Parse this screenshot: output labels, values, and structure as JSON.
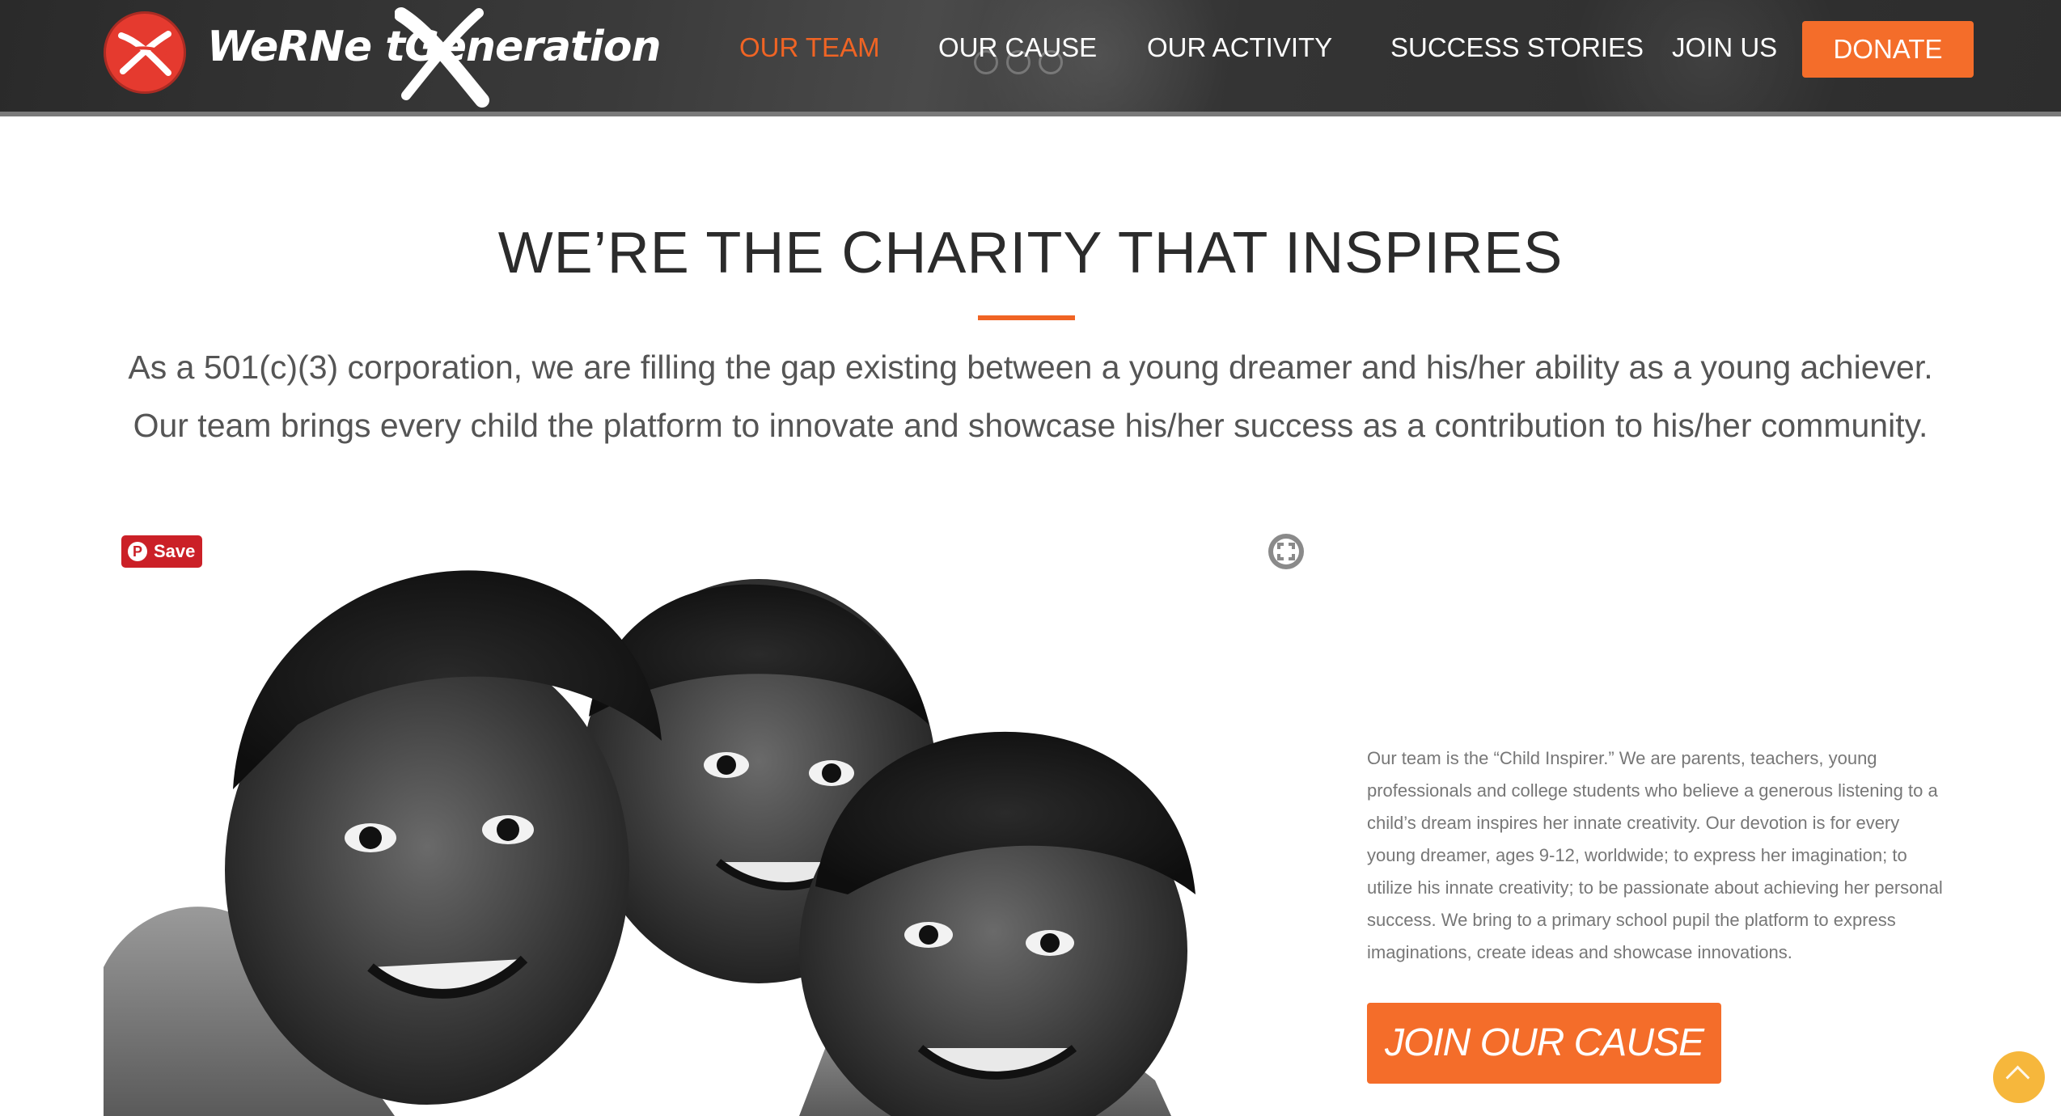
{
  "brand": {
    "name": "WeRNextGeneration",
    "logo_text": "WeRNe  tGeneration",
    "accent_color": "#f06424",
    "button_color": "#f46d2a",
    "logo_circle_color": "#e53a2f"
  },
  "nav": {
    "items": [
      {
        "label": "OUR TEAM",
        "active": true
      },
      {
        "label": "OUR CAUSE",
        "active": false
      },
      {
        "label": "OUR ACTIVITY",
        "active": false
      },
      {
        "label": "SUCCESS STORIES",
        "active": false
      },
      {
        "label": "JOIN US",
        "active": false
      }
    ],
    "donate_label": "DONATE"
  },
  "main": {
    "title": "WE’RE THE CHARITY THAT INSPIRES",
    "intro": "As a 501(c)(3) corporation, we are filling the gap existing between a young dreamer and his/her ability as a young achiever. Our team brings every child the platform to innovate and showcase his/her success as a contribution to his/her community."
  },
  "photo": {
    "save_label": "Save",
    "expand_icon": "expand-icon"
  },
  "team": {
    "description": "Our team is the “Child Inspirer.” We are parents, teachers, young professionals and college students who believe a generous listening to a child’s dream inspires her innate creativity. Our devotion is for every young dreamer, ages 9-12, worldwide; to express her imagination; to utilize his innate creativity; to be passionate about achieving her personal success. We bring to a primary school pupil the platform to express imaginations, create ideas and showcase innovations.",
    "join_label": "JOIN OUR CAUSE"
  },
  "icons": {
    "scroll_top": "chevron-up-icon",
    "pinterest": "pinterest-icon"
  }
}
